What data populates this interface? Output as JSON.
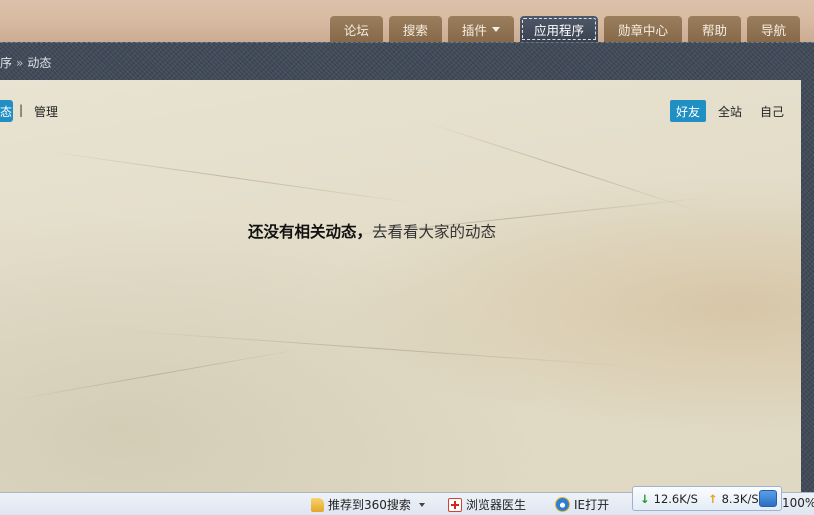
{
  "nav": {
    "items": [
      {
        "label": "论坛"
      },
      {
        "label": "搜索"
      },
      {
        "label": "插件"
      },
      {
        "label": "应用程序"
      },
      {
        "label": "勋章中心"
      },
      {
        "label": "帮助"
      },
      {
        "label": "导航"
      }
    ],
    "active_index": 3
  },
  "breadcrumb": {
    "parent": "序",
    "separator": "»",
    "current": "动态"
  },
  "feed": {
    "tab_label": "态",
    "separator": "|",
    "manage_label": "管理",
    "filters": [
      "好友",
      "全站",
      "自己"
    ],
    "active_filter": "好友",
    "empty_strong": "还没有相关动态，",
    "empty_link": "去看看大家的动态"
  },
  "statusbar": {
    "recommend_label": "推荐到360搜索",
    "doctor_label": "浏览器医生",
    "ie_label": "IE打开",
    "download_speed": "12.6K/S",
    "upload_speed": "8.3K/S",
    "zoom": "100%"
  },
  "colors": {
    "nav_tab": "#8d7050",
    "nav_tab_active": "#444c5a",
    "accent_blue": "#1f8fc4",
    "paper": "#e3ddc9",
    "denim": "#414a58"
  }
}
